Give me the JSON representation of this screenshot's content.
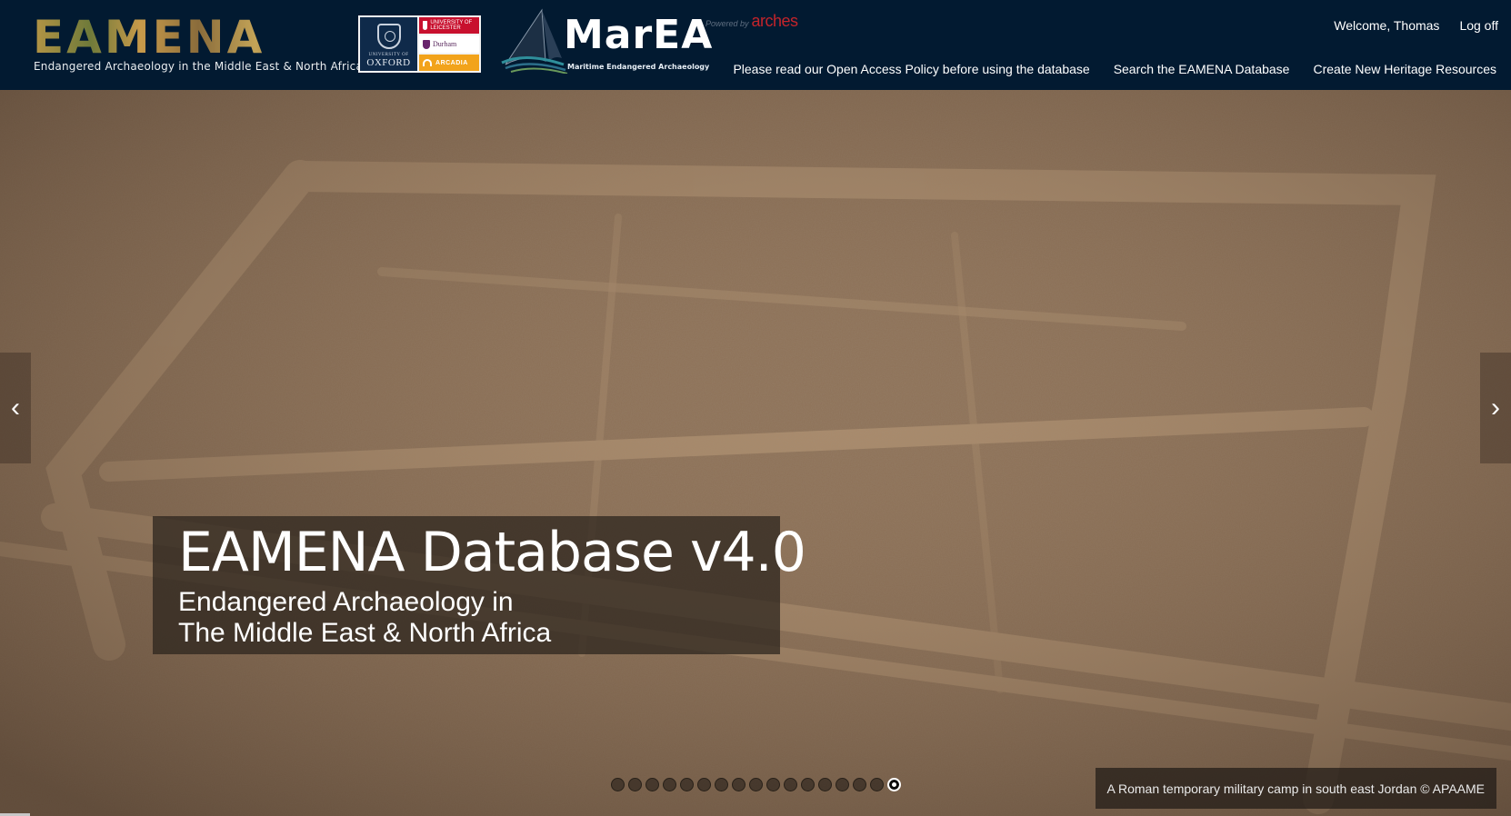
{
  "header": {
    "eamena_logo_word": "EAMENA",
    "eamena_tagline": "Endangered Archaeology in the Middle East & North Africa",
    "partners": {
      "oxford_small": "UNIVERSITY OF",
      "oxford_name": "OXFORD",
      "leicester": "UNIVERSITY OF LEICESTER",
      "durham": "Durham",
      "arcadia": "ARCADIA"
    },
    "marea_word": "MarEA",
    "marea_sub": "Maritime Endangered Archaeology",
    "powered_by": "Powered by",
    "arches": "arches",
    "welcome": "Welcome, Thomas",
    "log_off": "Log off",
    "nav": [
      "Please read our Open Access Policy before using the database",
      "Search the EAMENA Database",
      "Create New Heritage Resources"
    ]
  },
  "hero": {
    "title": "EAMENA Database v4.0",
    "subtitle_line1": "Endangered Archaeology in",
    "subtitle_line2": "The Middle East & North Africa",
    "credit": "A Roman temporary military camp in south east Jordan © APAAME",
    "prev_arrow": "‹",
    "next_arrow": "›",
    "slide_count": 17,
    "active_slide": 17
  },
  "colors": {
    "header_bg": "#021a31",
    "caption_bg": "#2a221c",
    "arches_red": "#c4242b",
    "arcadia_orange": "#f2a31b"
  }
}
